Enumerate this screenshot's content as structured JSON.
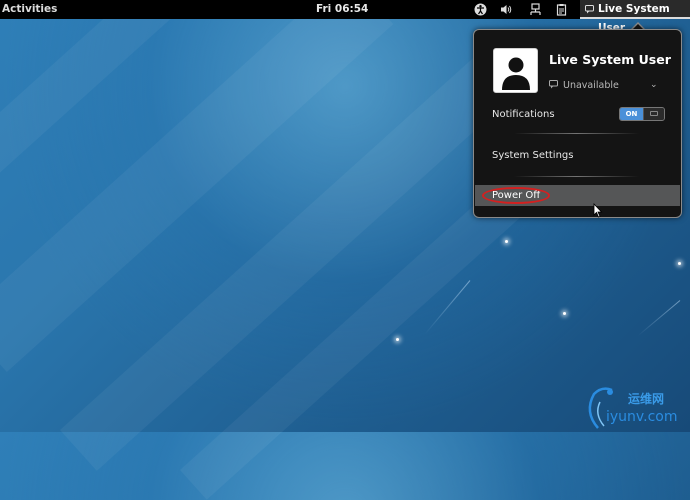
{
  "topbar": {
    "activities_label": "Activities",
    "clock": "Fri 06:54",
    "user_menu_label": "Live System User",
    "tray_icons": [
      "accessibility-icon",
      "volume-icon",
      "network-icon",
      "clipboard-icon"
    ]
  },
  "user_menu": {
    "user_name": "Live System User",
    "status": "Unavailable",
    "notifications_label": "Notifications",
    "notifications_toggle": "ON",
    "system_settings_label": "System Settings",
    "power_off_label": "Power Off"
  },
  "watermark": {
    "line1": "运维网",
    "line2": "iyunv.com"
  },
  "colors": {
    "accent": "#4a90d9",
    "highlight_ring": "#d42020",
    "topbar": "#000000"
  }
}
